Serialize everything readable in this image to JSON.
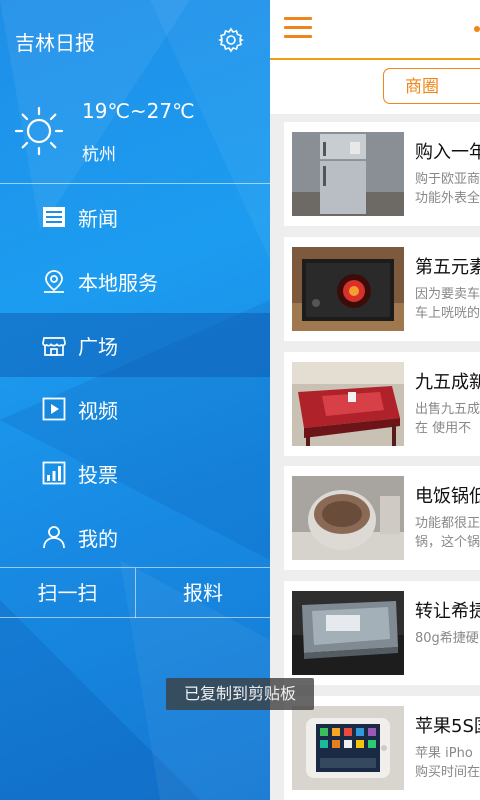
{
  "drawer": {
    "app_name": "吉林日报",
    "weather": {
      "temperature": "19℃~27℃",
      "city": "杭州",
      "icon": "sun-icon"
    },
    "menu": [
      {
        "label": "新闻",
        "icon": "news-icon"
      },
      {
        "label": "本地服务",
        "icon": "location-pin-icon"
      },
      {
        "label": "广场",
        "icon": "storefront-icon",
        "active": true
      },
      {
        "label": "视频",
        "icon": "play-icon"
      },
      {
        "label": "投票",
        "icon": "bar-chart-icon"
      },
      {
        "label": "我的",
        "icon": "user-icon"
      }
    ],
    "scan_label": "扫一扫",
    "report_label": "报料"
  },
  "content": {
    "tab_label": "商圈",
    "items": [
      {
        "title": "购入一年",
        "desc": "购于欧亚商\n功能外表全"
      },
      {
        "title": "第五元素",
        "desc": "因为要卖车\n车上咣咣的"
      },
      {
        "title": "九五成新",
        "desc": "出售九五成\n在 使用不"
      },
      {
        "title": "电饭锅低",
        "desc": "功能都很正\n锅，这个锅"
      },
      {
        "title": "转让希捷",
        "desc": "80g希捷硬"
      },
      {
        "title": "苹果5S国",
        "desc": "苹果 iPho\n购买时间在"
      }
    ]
  },
  "toast": "已复制到剪贴板",
  "colors": {
    "accent": "#f08519",
    "drawer_blue": "#1c9cf0"
  }
}
